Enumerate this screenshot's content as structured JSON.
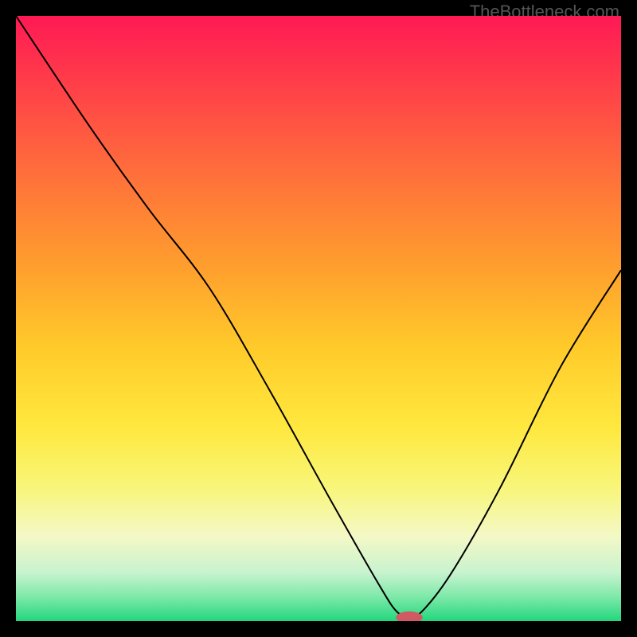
{
  "watermark": "TheBottleneck.com",
  "chart_data": {
    "type": "line",
    "title": "",
    "xlabel": "",
    "ylabel": "",
    "xlim": [
      0,
      100
    ],
    "ylim": [
      0,
      100
    ],
    "grid": false,
    "legend": null,
    "curve": [
      {
        "x": 0,
        "y": 100
      },
      {
        "x": 12,
        "y": 82
      },
      {
        "x": 22,
        "y": 68
      },
      {
        "x": 32,
        "y": 55
      },
      {
        "x": 42,
        "y": 38
      },
      {
        "x": 52,
        "y": 20
      },
      {
        "x": 60,
        "y": 6
      },
      {
        "x": 63,
        "y": 1.5
      },
      {
        "x": 65,
        "y": 1
      },
      {
        "x": 67,
        "y": 1.5
      },
      {
        "x": 72,
        "y": 8
      },
      {
        "x": 80,
        "y": 22
      },
      {
        "x": 90,
        "y": 42
      },
      {
        "x": 100,
        "y": 58
      }
    ],
    "marker": {
      "x": 65,
      "y": 0.6,
      "rx": 2.2,
      "ry": 1.0,
      "color": "#cf5a63"
    },
    "gradient_stops": [
      {
        "offset": 0.0,
        "color": "#ff1955"
      },
      {
        "offset": 0.1,
        "color": "#ff3a4a"
      },
      {
        "offset": 0.25,
        "color": "#ff6c3c"
      },
      {
        "offset": 0.4,
        "color": "#ff9a2e"
      },
      {
        "offset": 0.55,
        "color": "#ffcb2a"
      },
      {
        "offset": 0.68,
        "color": "#ffe83f"
      },
      {
        "offset": 0.78,
        "color": "#f8f67a"
      },
      {
        "offset": 0.86,
        "color": "#f4f8c6"
      },
      {
        "offset": 0.92,
        "color": "#c8f3cf"
      },
      {
        "offset": 0.96,
        "color": "#7de9a9"
      },
      {
        "offset": 1.0,
        "color": "#23d67d"
      }
    ]
  }
}
